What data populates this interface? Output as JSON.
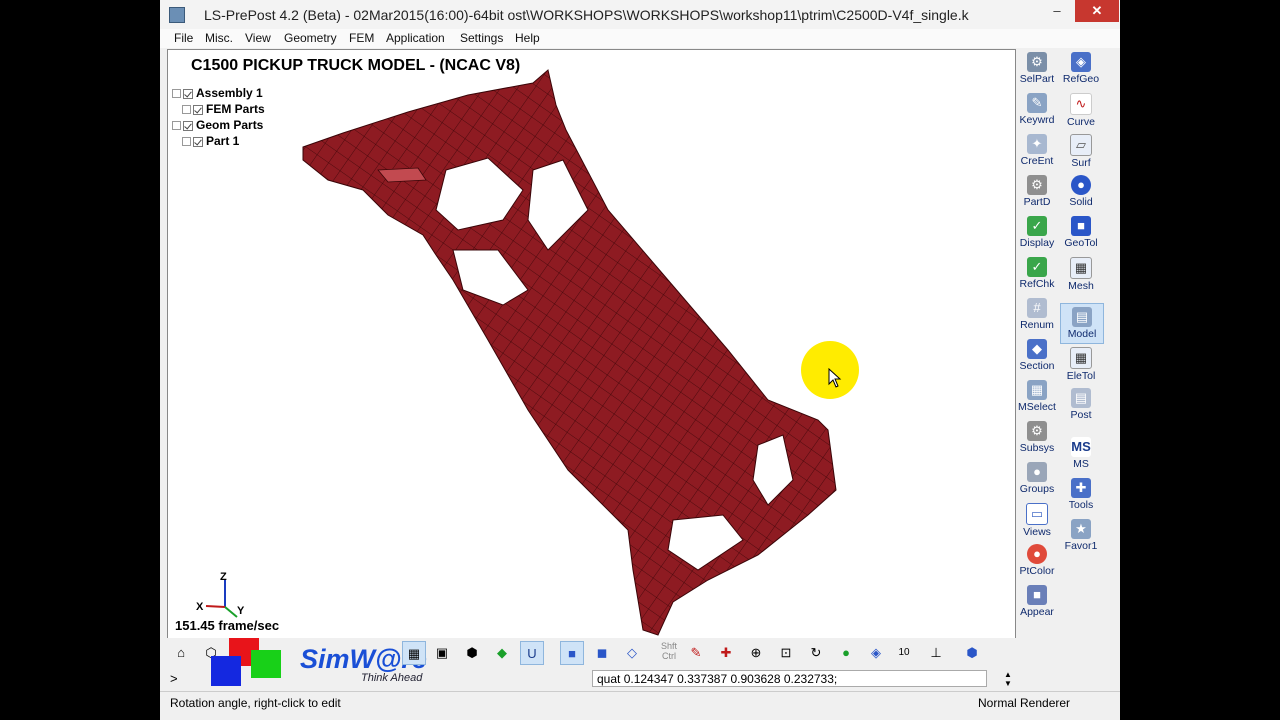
{
  "window": {
    "title": "LS-PrePost 4.2 (Beta) - 02Mar2015(16:00)-64bit ost\\WORKSHOPS\\WORKSHOPS\\workshop11\\ptrim\\C2500D-V4f_single.k",
    "min_glyph": "–",
    "max_glyph": "□",
    "close_glyph": "✕"
  },
  "menu": [
    "File",
    "Misc.",
    "View",
    "Geometry",
    "FEM",
    "Application",
    "Settings",
    "Help"
  ],
  "viewport": {
    "model_title": "C1500 PICKUP TRUCK MODEL - (NCAC V8)",
    "frame_rate": "151.45 frame/sec",
    "axes": {
      "z": "Z",
      "x": "X",
      "y": "Y"
    },
    "tree": [
      {
        "label": "Assembly 1"
      },
      {
        "label": "FEM Parts"
      },
      {
        "label": "Geom Parts"
      },
      {
        "label": "Part 1"
      }
    ],
    "mesh_color": "#8e1b22"
  },
  "sidebar": {
    "left": [
      "SelPart",
      "Keywrd",
      "CreEnt",
      "PartD",
      "Display",
      "RefChk",
      "Renum",
      "Section",
      "MSelect",
      "Subsys",
      "Groups",
      "Views",
      "PtColor",
      "Appear"
    ],
    "right": [
      "RefGeo",
      "Curve",
      "Surf",
      "Solid",
      "GeoTol",
      "Mesh",
      "Model",
      "EleTol",
      "Post",
      "MS",
      "Tools",
      "Favor1"
    ],
    "active": "Model"
  },
  "toolbar": {
    "shft_ctrl": "Shft Ctrl",
    "counter": "10",
    "u_label": "U"
  },
  "brand": {
    "name": "SimW@re",
    "tagline": "Think Ahead"
  },
  "command": {
    "prompt": ">",
    "value": "quat 0.124347 0.337387 0.903628 0.232733;"
  },
  "status": {
    "left": "Rotation angle, right-click to edit",
    "right": "Normal Renderer"
  }
}
